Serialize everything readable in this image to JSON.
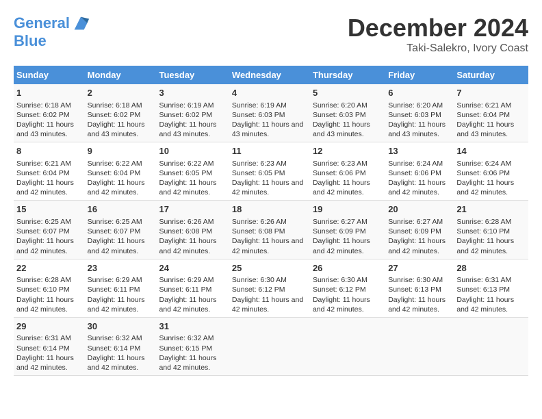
{
  "logo": {
    "line1": "General",
    "line2": "Blue"
  },
  "title": "December 2024",
  "subtitle": "Taki-Salekro, Ivory Coast",
  "days_of_week": [
    "Sunday",
    "Monday",
    "Tuesday",
    "Wednesday",
    "Thursday",
    "Friday",
    "Saturday"
  ],
  "weeks": [
    [
      {
        "day": "1",
        "sunrise": "6:18 AM",
        "sunset": "6:02 PM",
        "daylight": "11 hours and 43 minutes."
      },
      {
        "day": "2",
        "sunrise": "6:18 AM",
        "sunset": "6:02 PM",
        "daylight": "11 hours and 43 minutes."
      },
      {
        "day": "3",
        "sunrise": "6:19 AM",
        "sunset": "6:02 PM",
        "daylight": "11 hours and 43 minutes."
      },
      {
        "day": "4",
        "sunrise": "6:19 AM",
        "sunset": "6:03 PM",
        "daylight": "11 hours and 43 minutes."
      },
      {
        "day": "5",
        "sunrise": "6:20 AM",
        "sunset": "6:03 PM",
        "daylight": "11 hours and 43 minutes."
      },
      {
        "day": "6",
        "sunrise": "6:20 AM",
        "sunset": "6:03 PM",
        "daylight": "11 hours and 43 minutes."
      },
      {
        "day": "7",
        "sunrise": "6:21 AM",
        "sunset": "6:04 PM",
        "daylight": "11 hours and 43 minutes."
      }
    ],
    [
      {
        "day": "8",
        "sunrise": "6:21 AM",
        "sunset": "6:04 PM",
        "daylight": "11 hours and 42 minutes."
      },
      {
        "day": "9",
        "sunrise": "6:22 AM",
        "sunset": "6:04 PM",
        "daylight": "11 hours and 42 minutes."
      },
      {
        "day": "10",
        "sunrise": "6:22 AM",
        "sunset": "6:05 PM",
        "daylight": "11 hours and 42 minutes."
      },
      {
        "day": "11",
        "sunrise": "6:23 AM",
        "sunset": "6:05 PM",
        "daylight": "11 hours and 42 minutes."
      },
      {
        "day": "12",
        "sunrise": "6:23 AM",
        "sunset": "6:06 PM",
        "daylight": "11 hours and 42 minutes."
      },
      {
        "day": "13",
        "sunrise": "6:24 AM",
        "sunset": "6:06 PM",
        "daylight": "11 hours and 42 minutes."
      },
      {
        "day": "14",
        "sunrise": "6:24 AM",
        "sunset": "6:06 PM",
        "daylight": "11 hours and 42 minutes."
      }
    ],
    [
      {
        "day": "15",
        "sunrise": "6:25 AM",
        "sunset": "6:07 PM",
        "daylight": "11 hours and 42 minutes."
      },
      {
        "day": "16",
        "sunrise": "6:25 AM",
        "sunset": "6:07 PM",
        "daylight": "11 hours and 42 minutes."
      },
      {
        "day": "17",
        "sunrise": "6:26 AM",
        "sunset": "6:08 PM",
        "daylight": "11 hours and 42 minutes."
      },
      {
        "day": "18",
        "sunrise": "6:26 AM",
        "sunset": "6:08 PM",
        "daylight": "11 hours and 42 minutes."
      },
      {
        "day": "19",
        "sunrise": "6:27 AM",
        "sunset": "6:09 PM",
        "daylight": "11 hours and 42 minutes."
      },
      {
        "day": "20",
        "sunrise": "6:27 AM",
        "sunset": "6:09 PM",
        "daylight": "11 hours and 42 minutes."
      },
      {
        "day": "21",
        "sunrise": "6:28 AM",
        "sunset": "6:10 PM",
        "daylight": "11 hours and 42 minutes."
      }
    ],
    [
      {
        "day": "22",
        "sunrise": "6:28 AM",
        "sunset": "6:10 PM",
        "daylight": "11 hours and 42 minutes."
      },
      {
        "day": "23",
        "sunrise": "6:29 AM",
        "sunset": "6:11 PM",
        "daylight": "11 hours and 42 minutes."
      },
      {
        "day": "24",
        "sunrise": "6:29 AM",
        "sunset": "6:11 PM",
        "daylight": "11 hours and 42 minutes."
      },
      {
        "day": "25",
        "sunrise": "6:30 AM",
        "sunset": "6:12 PM",
        "daylight": "11 hours and 42 minutes."
      },
      {
        "day": "26",
        "sunrise": "6:30 AM",
        "sunset": "6:12 PM",
        "daylight": "11 hours and 42 minutes."
      },
      {
        "day": "27",
        "sunrise": "6:30 AM",
        "sunset": "6:13 PM",
        "daylight": "11 hours and 42 minutes."
      },
      {
        "day": "28",
        "sunrise": "6:31 AM",
        "sunset": "6:13 PM",
        "daylight": "11 hours and 42 minutes."
      }
    ],
    [
      {
        "day": "29",
        "sunrise": "6:31 AM",
        "sunset": "6:14 PM",
        "daylight": "11 hours and 42 minutes."
      },
      {
        "day": "30",
        "sunrise": "6:32 AM",
        "sunset": "6:14 PM",
        "daylight": "11 hours and 42 minutes."
      },
      {
        "day": "31",
        "sunrise": "6:32 AM",
        "sunset": "6:15 PM",
        "daylight": "11 hours and 42 minutes."
      },
      null,
      null,
      null,
      null
    ]
  ]
}
